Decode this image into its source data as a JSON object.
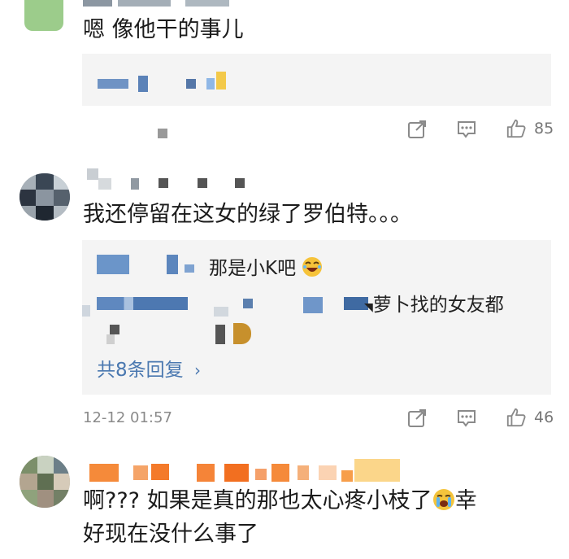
{
  "comments": [
    {
      "text": "嗯 像他干的事儿",
      "likes": "85"
    },
    {
      "text": "我还停留在这女的绿了罗伯特。。。",
      "replies": [
        {
          "text": "那是小K吧"
        },
        {
          "text": "萝卜找的女友都"
        }
      ],
      "more_replies": "共8条回复",
      "time": "12-12 01:57",
      "likes": "46"
    },
    {
      "line1": "啊??? 如果是真的那也太心疼小枝了",
      "line1_tail": "幸",
      "line2": "好现在没什么事了"
    }
  ],
  "icons": [
    "share-icon",
    "reply-icon",
    "like-icon",
    "laugh-emoji-icon",
    "cry-emoji-icon",
    "chevron-right-icon"
  ],
  "colors": {
    "link": "#4a78b0",
    "meta": "#8a8a8a",
    "box": "#f4f4f4"
  }
}
